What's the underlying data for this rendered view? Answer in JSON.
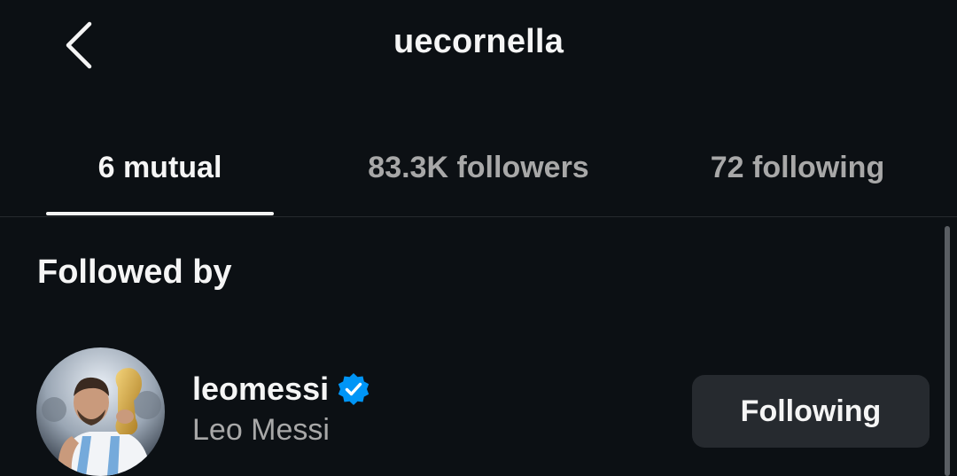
{
  "header": {
    "title": "uecornella",
    "back_icon": "chevron-left-icon"
  },
  "tabs": [
    {
      "label": "6 mutual",
      "active": true
    },
    {
      "label": "83.3K followers",
      "active": false
    },
    {
      "label": "72 following",
      "active": false
    }
  ],
  "section": {
    "heading": "Followed by"
  },
  "users": [
    {
      "username": "leomessi",
      "full_name": "Leo Messi",
      "verified": true,
      "verified_icon": "verified-badge-icon",
      "button_label": "Following"
    }
  ],
  "colors": {
    "background": "#0c1014",
    "text_primary": "#f5f5f5",
    "text_secondary": "#a8a8a8",
    "button_bg": "#262a2f",
    "verified_blue": "#0095f6"
  }
}
